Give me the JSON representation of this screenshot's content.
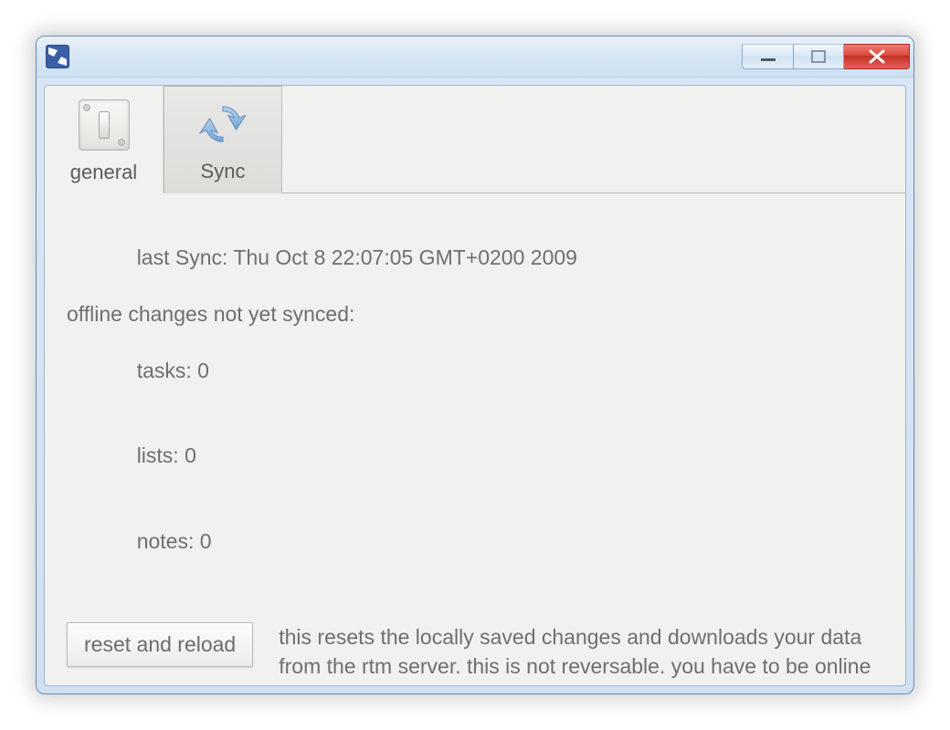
{
  "window": {
    "controls": {
      "minimize": "minimize",
      "maximize": "maximize",
      "close": "close"
    }
  },
  "tabs": {
    "general": {
      "label": "general"
    },
    "sync": {
      "label": "Sync"
    }
  },
  "sync": {
    "last_sync_label": "last Sync:",
    "last_sync_value": "Thu Oct 8 22:07:05 GMT+0200 2009",
    "offline_heading": "offline changes not yet synced:",
    "tasks_label": "tasks:",
    "tasks_count": "0",
    "lists_label": "lists:",
    "lists_count": "0",
    "notes_label": "notes:",
    "notes_count": "0",
    "reset_button": "reset and reload",
    "reset_description": "this resets the locally saved changes and downloads your data from the rtm server. this is not reversable. you have to be online to do this."
  }
}
